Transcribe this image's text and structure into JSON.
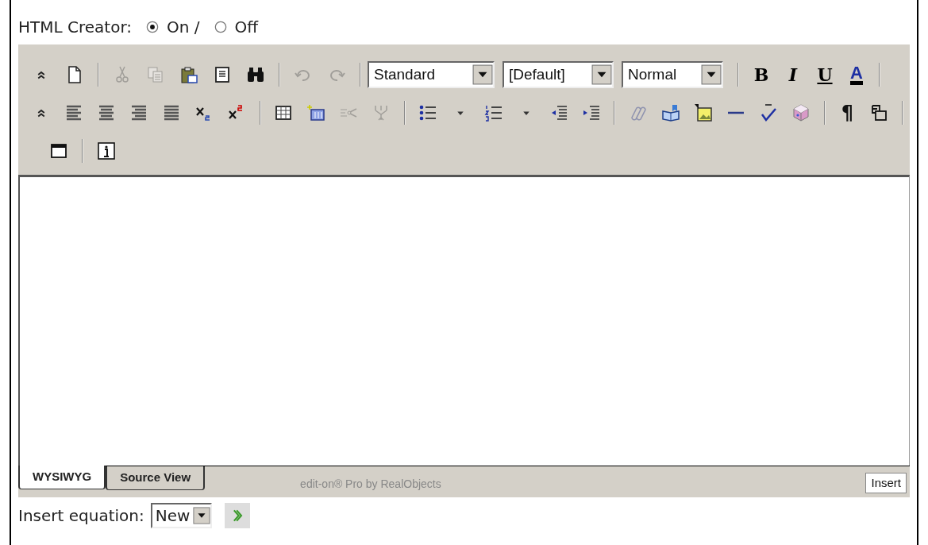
{
  "html_creator": {
    "label": "HTML Creator:",
    "options": [
      {
        "label": "On /",
        "selected": true
      },
      {
        "label": "Off",
        "selected": false
      }
    ]
  },
  "toolbar": {
    "row_1_buttons": [
      {
        "disabled": false
      },
      {
        "disabled": false
      },
      {
        "disabled": true
      },
      {
        "disabled": true
      },
      {
        "disabled": false
      },
      {
        "disabled": false
      },
      {
        "disabled": false
      },
      {
        "disabled": true
      },
      {
        "disabled": true
      }
    ],
    "selects": [
      {
        "value": "Standard"
      },
      {
        "value": "[Default]"
      },
      {
        "value": "Normal"
      }
    ],
    "format_buttons": [
      "B",
      "I",
      "U",
      "A"
    ],
    "row_2_buttons": [
      {
        "disabled": false
      },
      {
        "disabled": false
      },
      {
        "disabled": false
      },
      {
        "disabled": false
      },
      {
        "disabled": false
      },
      {
        "disabled": false
      },
      {
        "disabled": false
      },
      {
        "disabled": false
      },
      {
        "disabled": false
      },
      {
        "disabled": true
      },
      {
        "disabled": true
      },
      {
        "disabled": false
      },
      {
        "disabled": false
      },
      {
        "disabled": false
      },
      {
        "disabled": false
      },
      {
        "disabled": false
      },
      {
        "disabled": false
      },
      {
        "disabled": true
      },
      {
        "disabled": false
      },
      {
        "disabled": false
      },
      {
        "disabled": false
      },
      {
        "disabled": false
      },
      {
        "disabled": false
      }
    ],
    "pilcrow": "¶",
    "row_3_buttons": [
      {
        "disabled": false
      },
      {
        "disabled": false
      }
    ]
  },
  "tabs": [
    {
      "label": "WYSIWYG",
      "selected": true
    },
    {
      "label": "Source View",
      "selected": false
    }
  ],
  "footer_credit": "edit-on® Pro by RealObjects",
  "insert_button": "Insert",
  "equation": {
    "label": "Insert equation:",
    "value": "New"
  }
}
